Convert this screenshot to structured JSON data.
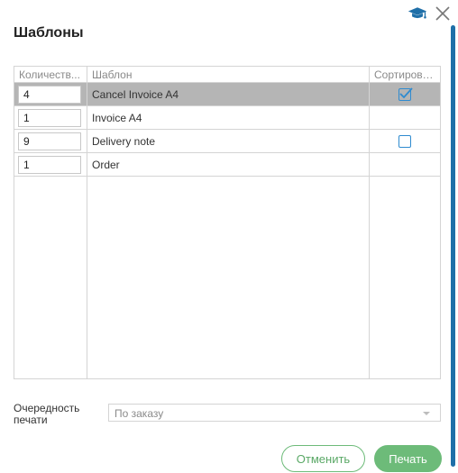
{
  "dialog": {
    "title": "Шаблоны"
  },
  "icons": {
    "help": "graduation-cap-icon",
    "close": "close-icon",
    "accent": "#1f6fa8"
  },
  "grid": {
    "columns": [
      "Количеств...",
      "Шаблон",
      "Сортирова..."
    ],
    "rows": [
      {
        "qty": "4",
        "template": "Cancel Invoice A4",
        "sort_checkbox": true,
        "sort_checked": true,
        "selected": true
      },
      {
        "qty": "1",
        "template": "Invoice A4",
        "sort_checkbox": false,
        "sort_checked": false,
        "selected": false
      },
      {
        "qty": "9",
        "template": "Delivery note",
        "sort_checkbox": true,
        "sort_checked": false,
        "selected": false
      },
      {
        "qty": "1",
        "template": "Order",
        "sort_checkbox": false,
        "sort_checked": false,
        "selected": false
      }
    ]
  },
  "print_order": {
    "label": "Очередность печати",
    "value": "По заказу"
  },
  "buttons": {
    "cancel": "Отменить",
    "print": "Печать"
  },
  "colors": {
    "checkbox": "#2f8bd0",
    "button_green": "#6dbb79",
    "selected_row": "#b5b5b5"
  }
}
